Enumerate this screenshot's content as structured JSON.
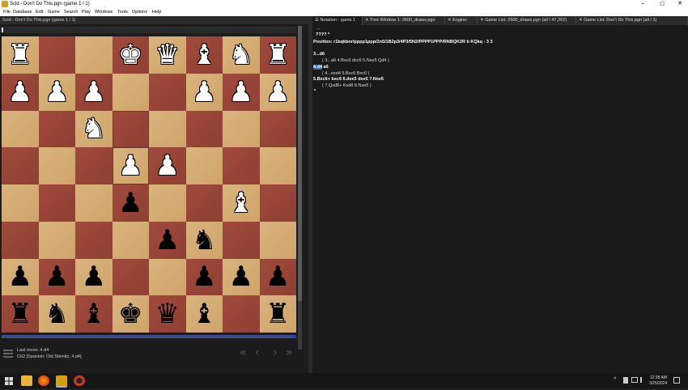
{
  "window": {
    "title": "Scid - Don't Do This.pgn (game 1 / 1)",
    "minimize": "–",
    "maximize": "◻",
    "close": "✕"
  },
  "menu": [
    "File",
    "Database",
    "Edit",
    "Game",
    "Search",
    "Play",
    "Windows",
    "Tools",
    "Options",
    "Help"
  ],
  "left_header": "Scid - Don't Do This.pgn (game 1 / 1)",
  "board": {
    "rows": [
      [
        "wR",
        "",
        "",
        "wK",
        "wQ",
        "wB",
        "wN",
        "wR"
      ],
      [
        "wP",
        "wP",
        "wP",
        "",
        "",
        "wP",
        "wP",
        "wP"
      ],
      [
        "",
        "",
        "wN",
        "",
        "",
        "",
        "",
        ""
      ],
      [
        "",
        "",
        "",
        "wP",
        "wP",
        "",
        "",
        ""
      ],
      [
        "",
        "",
        "",
        "bP",
        "",
        "",
        "wB",
        ""
      ],
      [
        "",
        "",
        "",
        "",
        "bP",
        "bN",
        "",
        ""
      ],
      [
        "bP",
        "bP",
        "bP",
        "",
        "",
        "bP",
        "bP",
        "bP"
      ],
      [
        "bR",
        "bN",
        "bB",
        "bK",
        "bQ",
        "bB",
        "",
        "bR"
      ]
    ],
    "highlight": [
      "3-3",
      "2-3"
    ]
  },
  "status": {
    "last_move": "Last move: 4.d4",
    "opening": "C62 [Spanish: Old Steinitz, 4.d4]"
  },
  "nav": [
    "«",
    "‹",
    "›",
    "»"
  ],
  "tabs": [
    {
      "label": "☰  Notation - game 1"
    },
    {
      "label": "✕  Tree Window 1: 2600_draws.pgn"
    },
    {
      "label": "✕  Engine:"
    },
    {
      "label": "✕  Game List: 2600_draws.pgn (all / 47,262)"
    },
    {
      "label": "✕  Game List: Don't Do This.pgn (all / 1)"
    }
  ],
  "notation": {
    "dots": "...",
    "tags": "????  *",
    "position": "Position: r1bqkbnr/pppp1ppp/2n5/1B2p3/4P3/5N2/PPPP1PPP/RNBQK2R b KQkq - 3 3",
    "line1": "3...d6",
    "var1": "( 3...a6 4.Bxc6 dxc6 5.Nxe5 Qd4 )",
    "line2_move": "4.d4",
    "line2_rest": " a6",
    "var2": "( 4...exd4 5.Bxc6 Bxc6 )",
    "line3": "5.Bxc6+ bxc6 6.dxe5 dxe5 7.Nxe5",
    "var3": "( 7.Qxd8+ Kxd8 8.Nxe5 )",
    "end": "*"
  },
  "tray": {
    "chevron": "^",
    "time": "12:38 AM",
    "date": "3/25/2024"
  },
  "colors": {
    "light_square": "#d8b47d",
    "dark_square": "#a04a3d",
    "highlight_move": "#3b6fb6"
  }
}
